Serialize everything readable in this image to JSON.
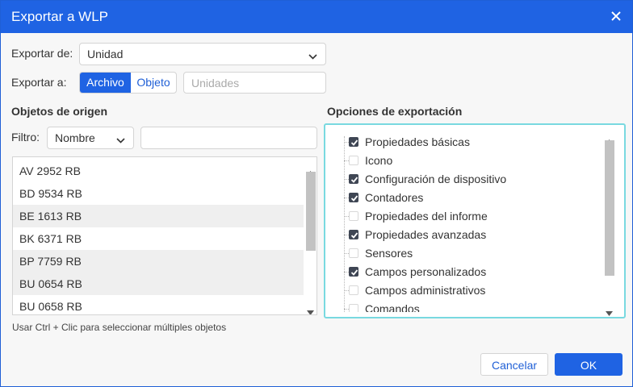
{
  "dialog": {
    "title": "Exportar a WLP"
  },
  "export_from": {
    "label": "Exportar de:",
    "value": "Unidad"
  },
  "export_to": {
    "label": "Exportar a:",
    "options": [
      "Archivo",
      "Objeto"
    ],
    "selected": "Archivo",
    "units_placeholder": "Unidades"
  },
  "source": {
    "heading": "Objetos de origen",
    "filter_label": "Filtro:",
    "filter_value": "Nombre",
    "filter_text": "",
    "items": [
      "AV 2952 RB",
      "BD 9534 RB",
      "BE 1613 RB",
      "BK 6371 RB",
      "BP 7759 RB",
      "BU 0654 RB",
      "BU 0658 RB"
    ],
    "hint": "Usar Ctrl + Clic para seleccionar múltiples objetos"
  },
  "options": {
    "heading": "Opciones de exportación",
    "items": [
      {
        "label": "Propiedades básicas",
        "checked": true
      },
      {
        "label": "Icono",
        "checked": false
      },
      {
        "label": "Configuración de dispositivo",
        "checked": true
      },
      {
        "label": "Contadores",
        "checked": true
      },
      {
        "label": "Propiedades del informe",
        "checked": false
      },
      {
        "label": "Propiedades avanzadas",
        "checked": true
      },
      {
        "label": "Sensores",
        "checked": false
      },
      {
        "label": "Campos personalizados",
        "checked": true
      },
      {
        "label": "Campos administrativos",
        "checked": false
      },
      {
        "label": "Comandos",
        "checked": false
      }
    ]
  },
  "buttons": {
    "cancel": "Cancelar",
    "ok": "OK"
  },
  "colors": {
    "accent": "#1f63e3",
    "focus_border": "#79d9e0",
    "checkbox_checked": "#3f4654"
  }
}
